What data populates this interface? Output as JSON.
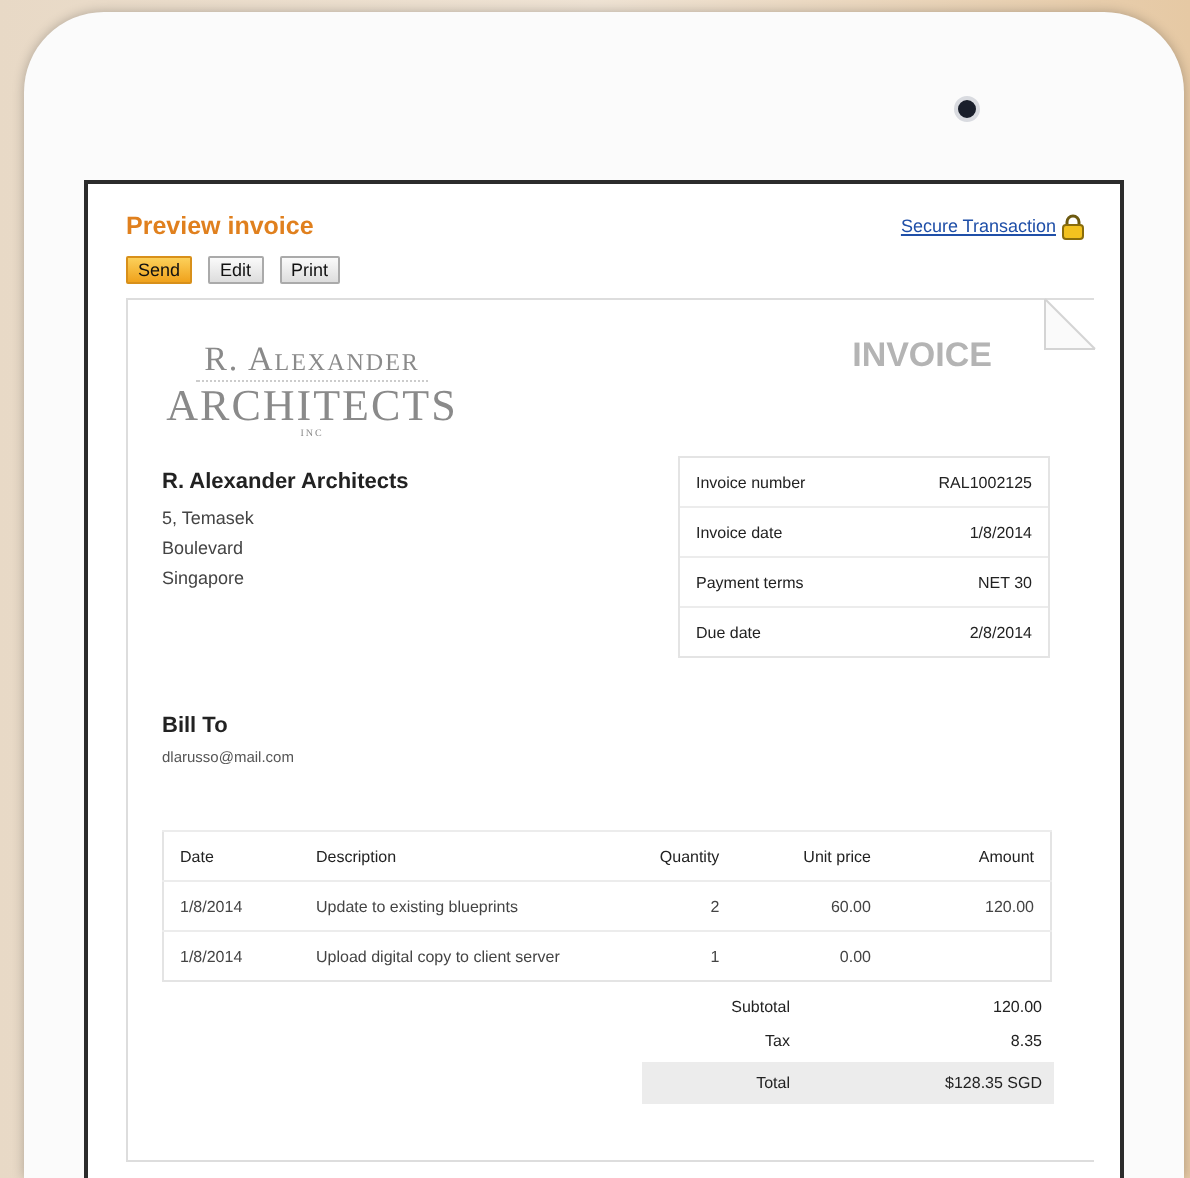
{
  "header": {
    "title": "Preview invoice",
    "secure_link": "Secure Transaction"
  },
  "buttons": [
    {
      "label": "Send",
      "primary": true
    },
    {
      "label": "Edit",
      "primary": false
    },
    {
      "label": "Print",
      "primary": false
    }
  ],
  "invoice": {
    "logo": {
      "line_1": "R. Alexander",
      "line_2": "ARCHITECTS",
      "line_3": "INC"
    },
    "heading": "INVOICE",
    "company": {
      "name": "R. Alexander Architects",
      "address": [
        "5, Temasek",
        "Boulevard",
        "Singapore"
      ]
    },
    "details": [
      {
        "label": "Invoice number",
        "value": "RAL1002125"
      },
      {
        "label": "Invoice date",
        "value": "1/8/2014"
      },
      {
        "label": "Payment terms",
        "value": "NET 30"
      },
      {
        "label": "Due date",
        "value": "2/8/2014"
      }
    ],
    "bill_to": {
      "heading": "Bill To",
      "email": "dlarusso@mail.com"
    },
    "items": {
      "columns": [
        "Date",
        "Description",
        "Quantity",
        "Unit price",
        "Amount"
      ],
      "rows": [
        [
          "1/8/2014",
          "Update to existing blueprints",
          "2",
          "60.00",
          "120.00"
        ],
        [
          "1/8/2014",
          "Upload digital copy to client server",
          "1",
          "0.00",
          ""
        ]
      ]
    },
    "totals": [
      {
        "label": "Subtotal",
        "value": "120.00",
        "emphasis": false
      },
      {
        "label": "Tax",
        "value": "8.35",
        "emphasis": false
      },
      {
        "label": "Total",
        "value": "$128.35 SGD",
        "emphasis": true
      }
    ]
  }
}
